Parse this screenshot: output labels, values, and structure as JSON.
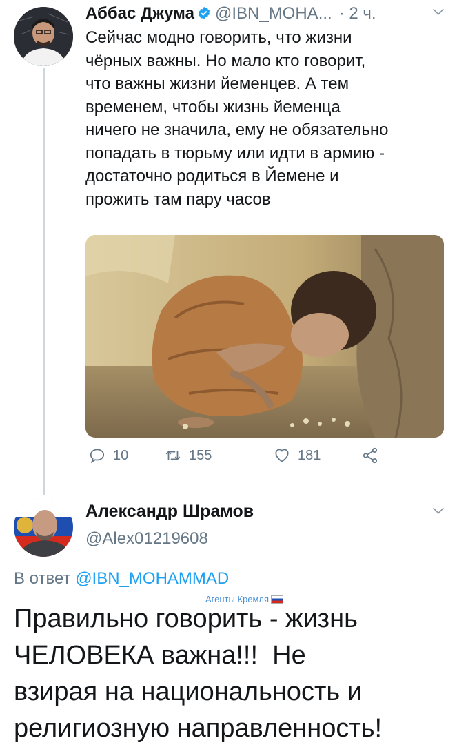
{
  "tweet": {
    "author_name": "Аббас Джума",
    "handle": "@IBN_МОНА...",
    "time": "· 2 ч.",
    "text_lines": [
      "Сейчас модно говорить, что жизни",
      "чёрных важны. Но мало кто говорит,",
      "что важны жизни йеменцев. А тем",
      "временем, чтобы жизнь йеменца",
      "ничего не значила, ему не обязательно",
      "попадать в тюрьму или идти в армию -",
      "достаточно родиться в Йемене и",
      "прожить там пару часов"
    ],
    "actions": {
      "replies": "10",
      "retweets": "155",
      "likes": "181"
    }
  },
  "reply": {
    "author_name": "Александр Шрамов",
    "handle": "@Alex01219608",
    "reply_prefix": "В ответ ",
    "reply_mention": "@IBN_MOHAMMAD",
    "sticker": "Агенты Кремля",
    "text_lines": [
      "Правильно говорить - жизнь",
      "ЧЕЛОВЕКА важна!!!  Не",
      "взирая на национальность и",
      "религиозную направленность!"
    ]
  },
  "icons": {
    "verified": "verified-badge-icon",
    "reply": "reply-icon",
    "retweet": "retweet-icon",
    "like": "heart-icon",
    "share": "share-icon",
    "menu": "chevron-down-icon"
  },
  "colors": {
    "accent": "#1da1f2",
    "secondary_text": "#657786",
    "text": "#14171a",
    "thread_line": "#ccd6dd"
  }
}
